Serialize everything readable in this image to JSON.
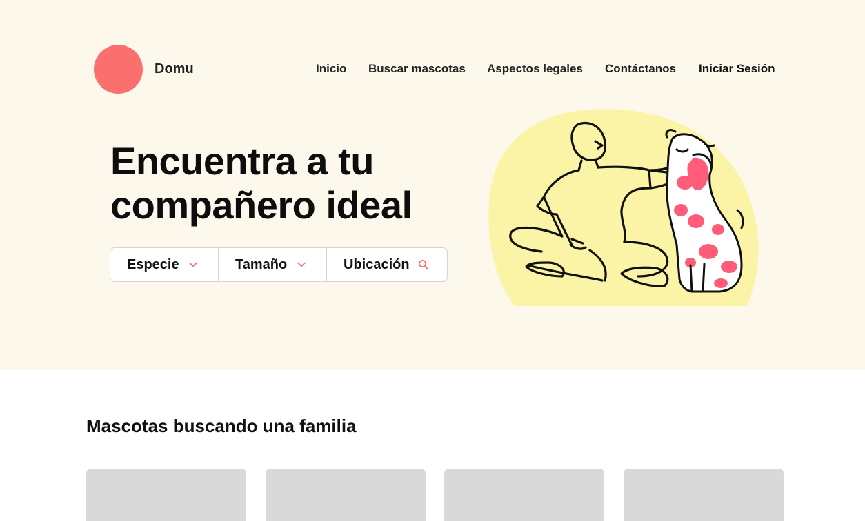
{
  "brand": {
    "name": "Domu",
    "logo_color": "#fb6f6f"
  },
  "nav": {
    "items": [
      {
        "label": "Inicio"
      },
      {
        "label": "Buscar mascotas"
      },
      {
        "label": "Aspectos legales"
      },
      {
        "label": "Contáctanos"
      },
      {
        "label": "Iniciar Sesión"
      }
    ]
  },
  "hero": {
    "title_line1": "Encuentra a tu",
    "title_line2": "compañero ideal",
    "background": "#fdf8ec",
    "blob_color": "#fbf3a6",
    "dog_spot_color": "#ff5c7a"
  },
  "search": {
    "filters": [
      {
        "label": "Especie",
        "icon": "chevron-down-icon"
      },
      {
        "label": "Tamaño",
        "icon": "chevron-down-icon"
      },
      {
        "label": "Ubicación",
        "icon": "search-icon"
      }
    ],
    "accent": "#fb6f6f"
  },
  "pets_section": {
    "title": "Mascotas buscando una familia",
    "card_placeholder_color": "#d9d9d9"
  }
}
